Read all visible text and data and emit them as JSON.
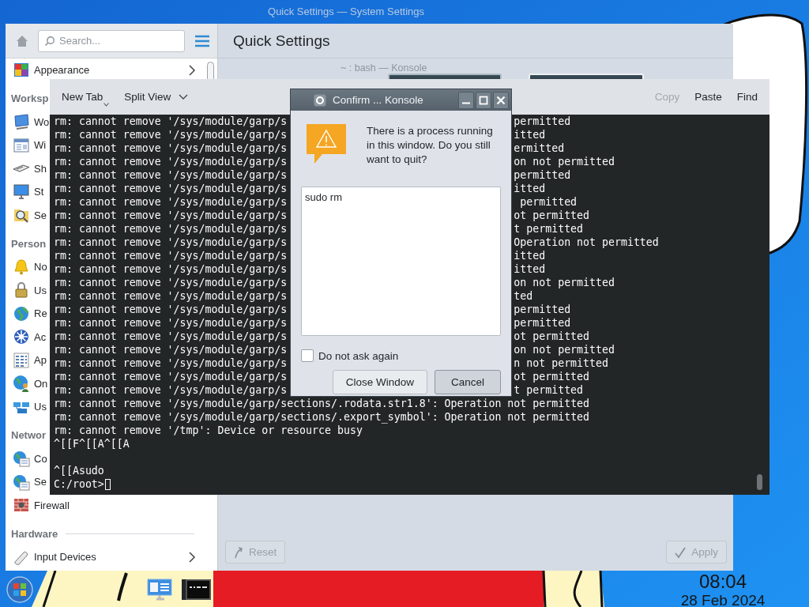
{
  "desktop": {
    "taskbar_items": [
      {
        "kind": "start"
      },
      {
        "kind": "monitor"
      },
      {
        "kind": "terminal"
      }
    ],
    "clock": {
      "time": "08:04",
      "date": "28 Feb 2024"
    }
  },
  "settings_window": {
    "title": "Quick Settings — System Settings",
    "search": {
      "placeholder": "Search..."
    },
    "sidebar": {
      "sections": [
        {
          "items": [
            {
              "label": "Appearance",
              "expandable": true
            }
          ]
        },
        {
          "title": "Worksp",
          "items": [
            {
              "label": "Wo",
              "expandable": false
            },
            {
              "label": "Wi",
              "expandable": false
            },
            {
              "label": "Sh",
              "expandable": false
            },
            {
              "label": "St",
              "expandable": false
            },
            {
              "label": "Se",
              "expandable": false
            }
          ]
        },
        {
          "title": "Person",
          "items": [
            {
              "label": "No",
              "expandable": false
            },
            {
              "label": "Us",
              "expandable": false
            },
            {
              "label": "Re",
              "expandable": false
            },
            {
              "label": "Ac",
              "expandable": false
            },
            {
              "label": "Ap",
              "expandable": false
            },
            {
              "label": "On",
              "expandable": false
            },
            {
              "label": "Us",
              "expandable": false
            }
          ]
        },
        {
          "title": "Networ",
          "items": [
            {
              "label": "Co",
              "expandable": false
            },
            {
              "label": "Se",
              "expandable": false
            },
            {
              "label": "Firewall",
              "expandable": false
            }
          ]
        },
        {
          "title": "Hardware",
          "items": [
            {
              "label": "Input Devices",
              "expandable": true
            }
          ]
        }
      ]
    },
    "page_title": "Quick Settings",
    "buttons": [
      {
        "label": "Reset",
        "kind": "reset",
        "disabled": true
      },
      {
        "label": "Apply",
        "kind": "apply",
        "disabled": true
      }
    ]
  },
  "konsole_window": {
    "title": "~ : bash — Konsole",
    "toolbar": {
      "left": [
        {
          "label": "New Tab",
          "kind": "menu"
        },
        {
          "label": "Split View",
          "kind": "dropdown"
        }
      ],
      "right": [
        {
          "label": "Copy",
          "disabled": true
        },
        {
          "label": "Paste",
          "disabled": false
        },
        {
          "label": "Find",
          "disabled": false
        }
      ]
    },
    "terminal": {
      "lines": [
        {
          "kind": "split",
          "left": "rm: cannot remove '/sys/module/garp/s",
          "right": "permitted"
        },
        {
          "kind": "split",
          "left": "rm: cannot remove '/sys/module/garp/s",
          "right": "itted"
        },
        {
          "kind": "split",
          "left": "rm: cannot remove '/sys/module/garp/s",
          "right": "ermitted"
        },
        {
          "kind": "split",
          "left": "rm: cannot remove '/sys/module/garp/s",
          "right": "on not permitted"
        },
        {
          "kind": "split",
          "left": "rm: cannot remove '/sys/module/garp/s",
          "right": "permitted"
        },
        {
          "kind": "split",
          "left": "rm: cannot remove '/sys/module/garp/s",
          "right": "itted"
        },
        {
          "kind": "split",
          "left": "rm: cannot remove '/sys/module/garp/s",
          "right": " permitted"
        },
        {
          "kind": "split",
          "left": "rm: cannot remove '/sys/module/garp/s",
          "right": "ot permitted"
        },
        {
          "kind": "split",
          "left": "rm: cannot remove '/sys/module/garp/s",
          "right": "t permitted"
        },
        {
          "kind": "split",
          "left": "rm: cannot remove '/sys/module/garp/s",
          "right": "Operation not permitted"
        },
        {
          "kind": "split",
          "left": "rm: cannot remove '/sys/module/garp/s",
          "right": "itted"
        },
        {
          "kind": "split",
          "left": "rm: cannot remove '/sys/module/garp/s",
          "right": "itted"
        },
        {
          "kind": "split",
          "left": "rm: cannot remove '/sys/module/garp/s",
          "right": "on not permitted"
        },
        {
          "kind": "split",
          "left": "rm: cannot remove '/sys/module/garp/s",
          "right": "ted"
        },
        {
          "kind": "split",
          "left": "rm: cannot remove '/sys/module/garp/s",
          "right": "permitted"
        },
        {
          "kind": "split",
          "left": "rm: cannot remove '/sys/module/garp/s",
          "right": "permitted"
        },
        {
          "kind": "split",
          "left": "rm: cannot remove '/sys/module/garp/s",
          "right": "ot permitted"
        },
        {
          "kind": "split",
          "left": "rm: cannot remove '/sys/module/garp/s",
          "right": "on not permitted"
        },
        {
          "kind": "split",
          "left": "rm: cannot remove '/sys/module/garp/s",
          "right": "n not permitted"
        },
        {
          "kind": "split",
          "left": "rm: cannot remove '/sys/module/garp/s",
          "right": "ot permitted"
        },
        {
          "kind": "split",
          "left": "rm: cannot remove '/sys/module/garp/s",
          "right": "t permitted"
        },
        {
          "kind": "full",
          "text": "rm: cannot remove '/sys/module/garp/sections/.rodata.str1.8': Operation not permitted"
        },
        {
          "kind": "full",
          "text": "rm: cannot remove '/sys/module/garp/sections/.export_symbol': Operation not permitted"
        },
        {
          "kind": "full",
          "text": "rm: cannot remove '/tmp': Device or resource busy"
        },
        {
          "kind": "full",
          "text": "^[[F^[[A^[[A"
        },
        {
          "kind": "blank"
        },
        {
          "kind": "full",
          "text": "^[[Asudo"
        },
        {
          "kind": "prompt",
          "text": "C:/root>",
          "cursor": true
        }
      ]
    }
  },
  "dialog": {
    "title": "Confirm ... Konsole",
    "message": "There is a process running in this window. Do you still want to quit?",
    "text_area": {
      "value": "sudo rm"
    },
    "checkbox": {
      "label": "Do not ask again",
      "checked": false
    },
    "buttons": [
      {
        "label": "Close Window",
        "focused": false
      },
      {
        "label": "Cancel",
        "focused": true
      }
    ]
  }
}
